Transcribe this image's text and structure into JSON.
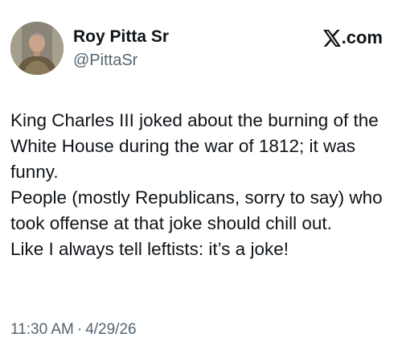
{
  "author": {
    "display_name": "Roy Pitta Sr",
    "handle": "@PittaSr",
    "avatar_icon": "profile-avatar-armored-man"
  },
  "brand": {
    "logo_icon": "x-logo-icon",
    "label": ".com"
  },
  "tweet": {
    "paragraphs": [
      "King Charles III joked about the burning of the White House during the war of 1812; it was funny.",
      "People (mostly Republicans, sorry to say) who took offense at that joke should chill out.",
      "Like I always tell leftists: it’s a joke!"
    ],
    "time": "11:30 AM",
    "separator": "·",
    "date": "4/29/26"
  },
  "colors": {
    "text_primary": "#0f1419",
    "text_secondary": "#536471",
    "background": "#ffffff"
  }
}
